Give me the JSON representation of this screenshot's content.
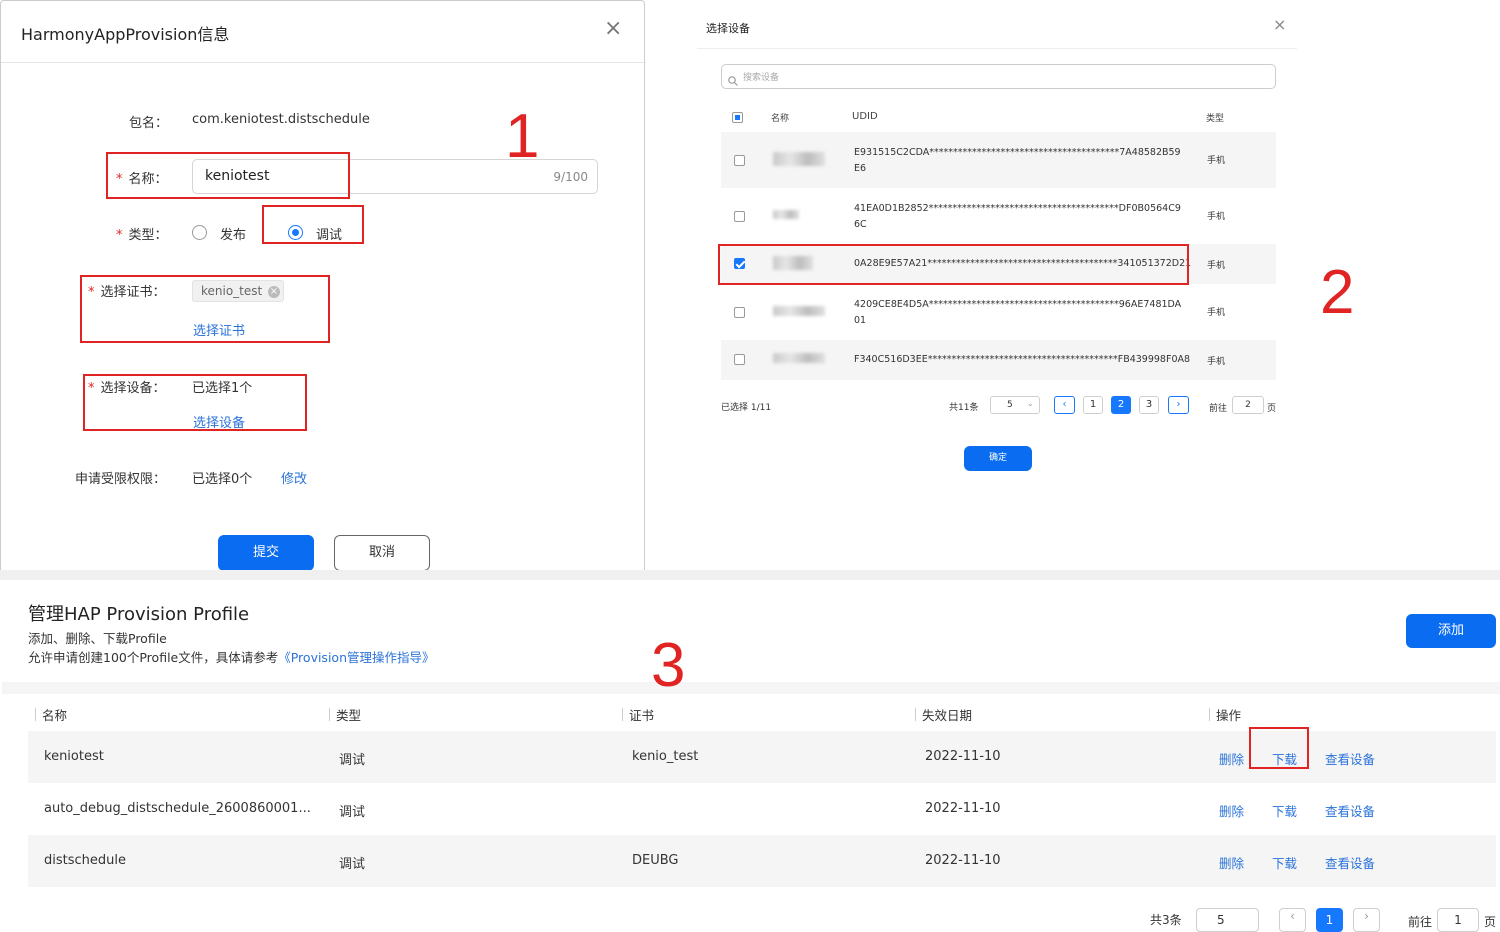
{
  "panel1": {
    "title": "HarmonyAppProvision信息",
    "package_label": "包名：",
    "package_value": "com.keniotest.distschedule",
    "name_label": "名称：",
    "name_value": "keniotest",
    "name_counter": "9/100",
    "type_label": "类型：",
    "type_options": [
      "发布",
      "调试"
    ],
    "cert_label": "选择证书：",
    "cert_tag": "kenio_test",
    "cert_link": "选择证书",
    "device_label": "选择设备：",
    "device_value": "已选择1个",
    "device_link": "选择设备",
    "perm_label": "申请受限权限：",
    "perm_value": "已选择0个",
    "perm_link": "修改",
    "submit": "提交",
    "cancel": "取消"
  },
  "panel2": {
    "title": "选择设备",
    "search_placeholder": "搜索设备",
    "columns": [
      "名称",
      "UDID",
      "类型"
    ],
    "rows": [
      {
        "udid": "E931515C2CDA****************************************7A48582B59E6",
        "type": "手机",
        "checked": false
      },
      {
        "udid": "41EA0D1B2852****************************************DF0B0564C96C",
        "type": "手机",
        "checked": false
      },
      {
        "udid": "0A28E9E57A21****************************************341051372D21",
        "type": "手机",
        "checked": true
      },
      {
        "udid": "4209CE8E4D5A****************************************96AE7481DA01",
        "type": "手机",
        "checked": false
      },
      {
        "udid": "F340C516D3EE****************************************FB439998F0A8",
        "type": "手机",
        "checked": false
      }
    ],
    "selected_count": "已选择 1/11",
    "total": "共11条",
    "page_size": "5",
    "pages": [
      "1",
      "2",
      "3"
    ],
    "active_page": "2",
    "goto_label": "前往",
    "goto_value": "2",
    "page_unit": "页",
    "confirm": "确定"
  },
  "panel3": {
    "title": "管理HAP Provision Profile",
    "desc1": "添加、删除、下载Profile",
    "desc2_prefix": "允许申请创建100个Profile文件，具体请参考",
    "desc2_link": "《Provision管理操作指导》",
    "add_button": "添加",
    "columns": [
      "名称",
      "类型",
      "证书",
      "失效日期",
      "操作"
    ],
    "rows": [
      {
        "name": "keniotest",
        "type": "调试",
        "cert": "kenio_test",
        "date": "2022-11-10"
      },
      {
        "name": "auto_debug_distschedule_2600860001...",
        "type": "调试",
        "cert": "",
        "date": "2022-11-10"
      },
      {
        "name": "distschedule",
        "type": "调试",
        "cert": "DEUBG",
        "date": "2022-11-10"
      }
    ],
    "actions": [
      "删除",
      "下载",
      "查看设备"
    ],
    "total": "共3条",
    "page_size": "5",
    "page": "1",
    "goto_label": "前往",
    "goto_value": "1",
    "page_unit": "页"
  },
  "annotations": [
    "1",
    "2",
    "3"
  ],
  "colors": {
    "primary": "#0a6cf0",
    "link": "#2a73d9",
    "highlight": "#e02424"
  }
}
